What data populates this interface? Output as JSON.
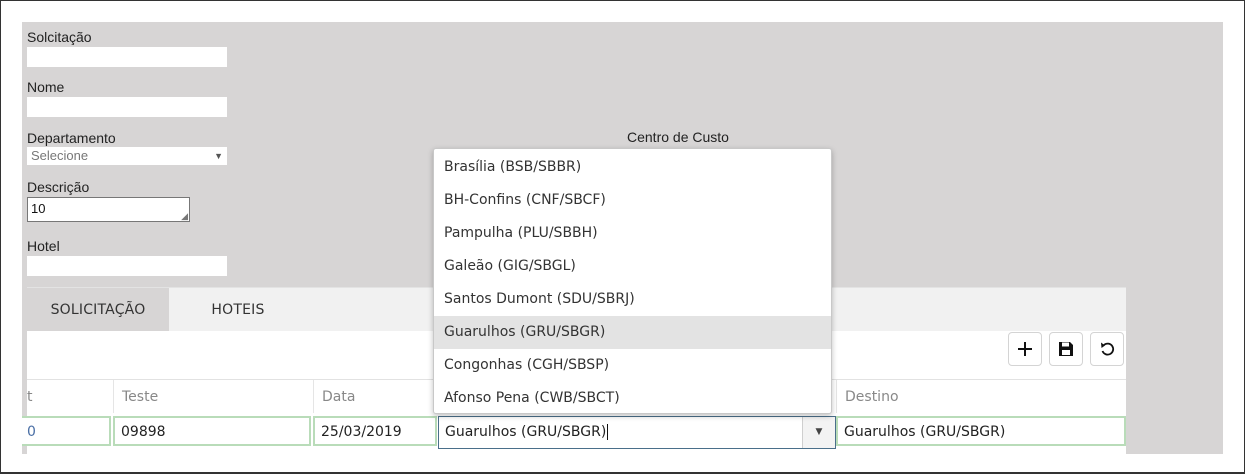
{
  "form": {
    "solicitacao_label": "Solcitação",
    "solicitacao_value": "",
    "nome_label": "Nome",
    "nome_value": "",
    "departamento_label": "Departamento",
    "departamento_selected": "Selecione",
    "centro_custo_label": "Centro de Custo",
    "descricao_label": "Descrição",
    "descricao_value": "10",
    "hotel_label": "Hotel",
    "hotel_value": ""
  },
  "tabs": [
    {
      "label": "SOLICITAÇÃO",
      "active": true
    },
    {
      "label": "HOTEIS",
      "active": false
    }
  ],
  "toolbar": {
    "add_icon": "plus-icon",
    "save_icon": "floppy-disk-icon",
    "undo_icon": "undo-icon"
  },
  "grid": {
    "columns": [
      "t",
      "Teste",
      "Data",
      "Destino"
    ],
    "row": {
      "first": "0",
      "teste": "09898",
      "data": "25/03/2019",
      "origem": "Guarulhos (GRU/SBGR)",
      "destino": "Guarulhos (GRU/SBGR)"
    }
  },
  "dropdown": {
    "items": [
      "Brasília (BSB/SBBR)",
      "BH-Confins (CNF/SBCF)",
      "Pampulha (PLU/SBBH)",
      "Galeão (GIG/SBGL)",
      "Santos Dumont (SDU/SBRJ)",
      "Guarulhos (GRU/SBGR)",
      "Congonhas (CGH/SBSP)",
      "Afonso Pena (CWB/SBCT)"
    ],
    "highlighted_index": 5
  },
  "colors": {
    "panel_bg": "#d7d5d5",
    "row_border": "#b9dcb9",
    "combo_border": "#4a6f8a",
    "highlight": "#e3e3e3"
  }
}
